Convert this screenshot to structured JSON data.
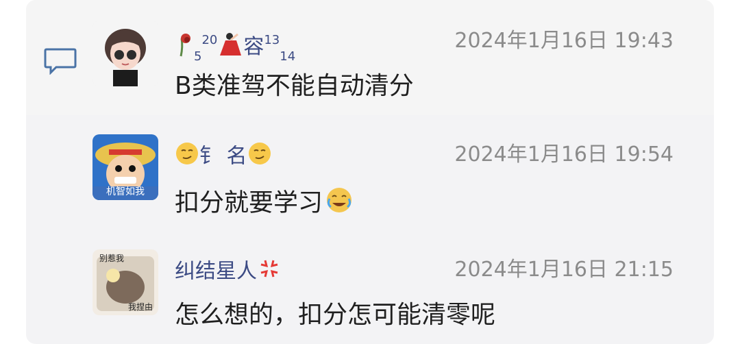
{
  "comments": [
    {
      "name_parts": [
        "5",
        "20",
        "容",
        "13",
        "14"
      ],
      "time": "2024年1月16日 19:43",
      "text": "B类准驾不能自动清分"
    },
    {
      "name": "钅 名",
      "time": "2024年1月16日 19:54",
      "text": "扣分就要学习",
      "avatar_caption": "机智如我"
    },
    {
      "name": "纠结星人",
      "time": "2024年1月16日 21:15",
      "text": "怎么想的，扣分怎可能清零呢",
      "avatar_caption_top": "别惹我",
      "avatar_caption_bottom": "我捏由"
    }
  ],
  "icons": {
    "comment_icon": "speech-bubble-icon",
    "emoji_smirk": "smirk-emoji-icon",
    "emoji_laugh_cry": "laugh-cry-emoji-icon",
    "emoji_anger": "anger-symbol-icon"
  },
  "colors": {
    "name": "#3c4b84",
    "time": "#8b8b8b",
    "text": "#1f1f1f",
    "accent_icon": "#4a73a6"
  }
}
